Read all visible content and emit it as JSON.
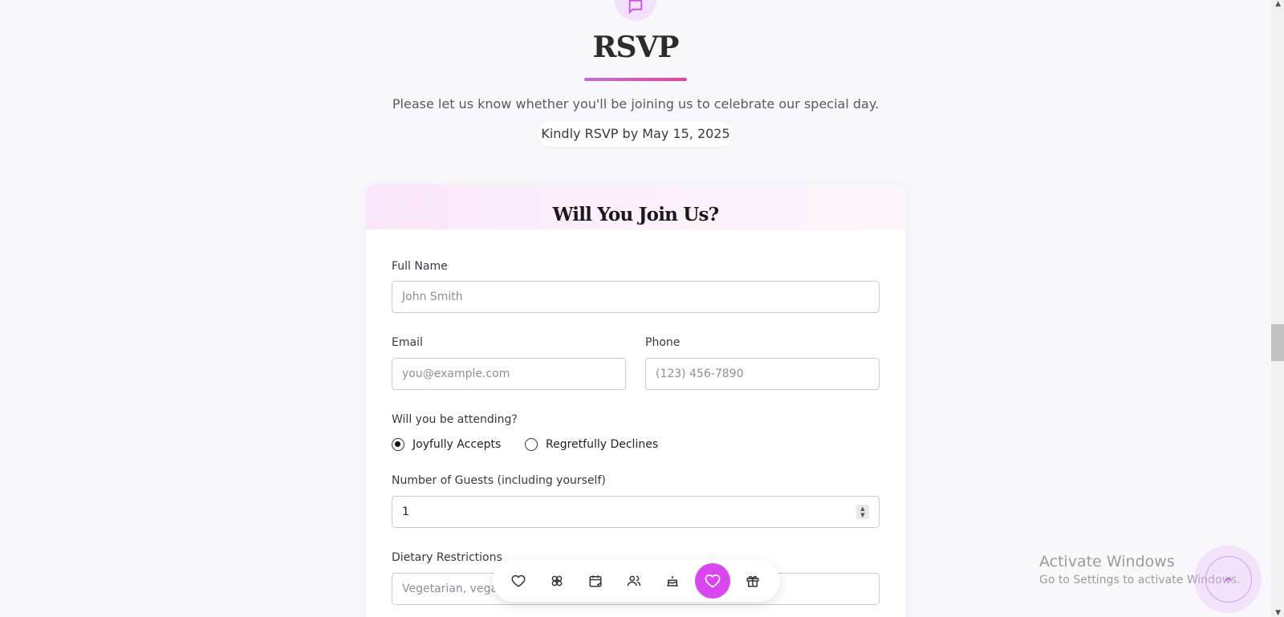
{
  "header": {
    "title": "RSVP",
    "subtitle": "Please let us know whether you'll be joining us to celebrate our special day.",
    "deadline": "Kindly RSVP by May 15, 2025"
  },
  "form": {
    "title": "Will You Join Us?",
    "full_name_label": "Full Name",
    "full_name_placeholder": "John Smith",
    "email_label": "Email",
    "email_placeholder": "you@example.com",
    "phone_label": "Phone",
    "phone_placeholder": "(123) 456-7890",
    "attending_label": "Will you be attending?",
    "attending_options": [
      "Joyfully Accepts",
      "Regretfully Declines"
    ],
    "attending_selected": "Joyfully Accepts",
    "guests_label": "Number of Guests (including yourself)",
    "guests_value": "1",
    "dietary_label": "Dietary Restrictions",
    "dietary_placeholder": "Vegetarian, vegan"
  },
  "bottom_nav": {
    "items": [
      "heart-icon",
      "flower-icon",
      "calendar-icon",
      "people-icon",
      "cake-icon",
      "heart-icon",
      "gift-icon"
    ],
    "active_index": 5
  },
  "watermark": {
    "title": "Activate Windows",
    "subtitle": "Go to Settings to activate Windows."
  },
  "colors": {
    "accent": "#d946ef",
    "background": "#f8f8fd"
  }
}
